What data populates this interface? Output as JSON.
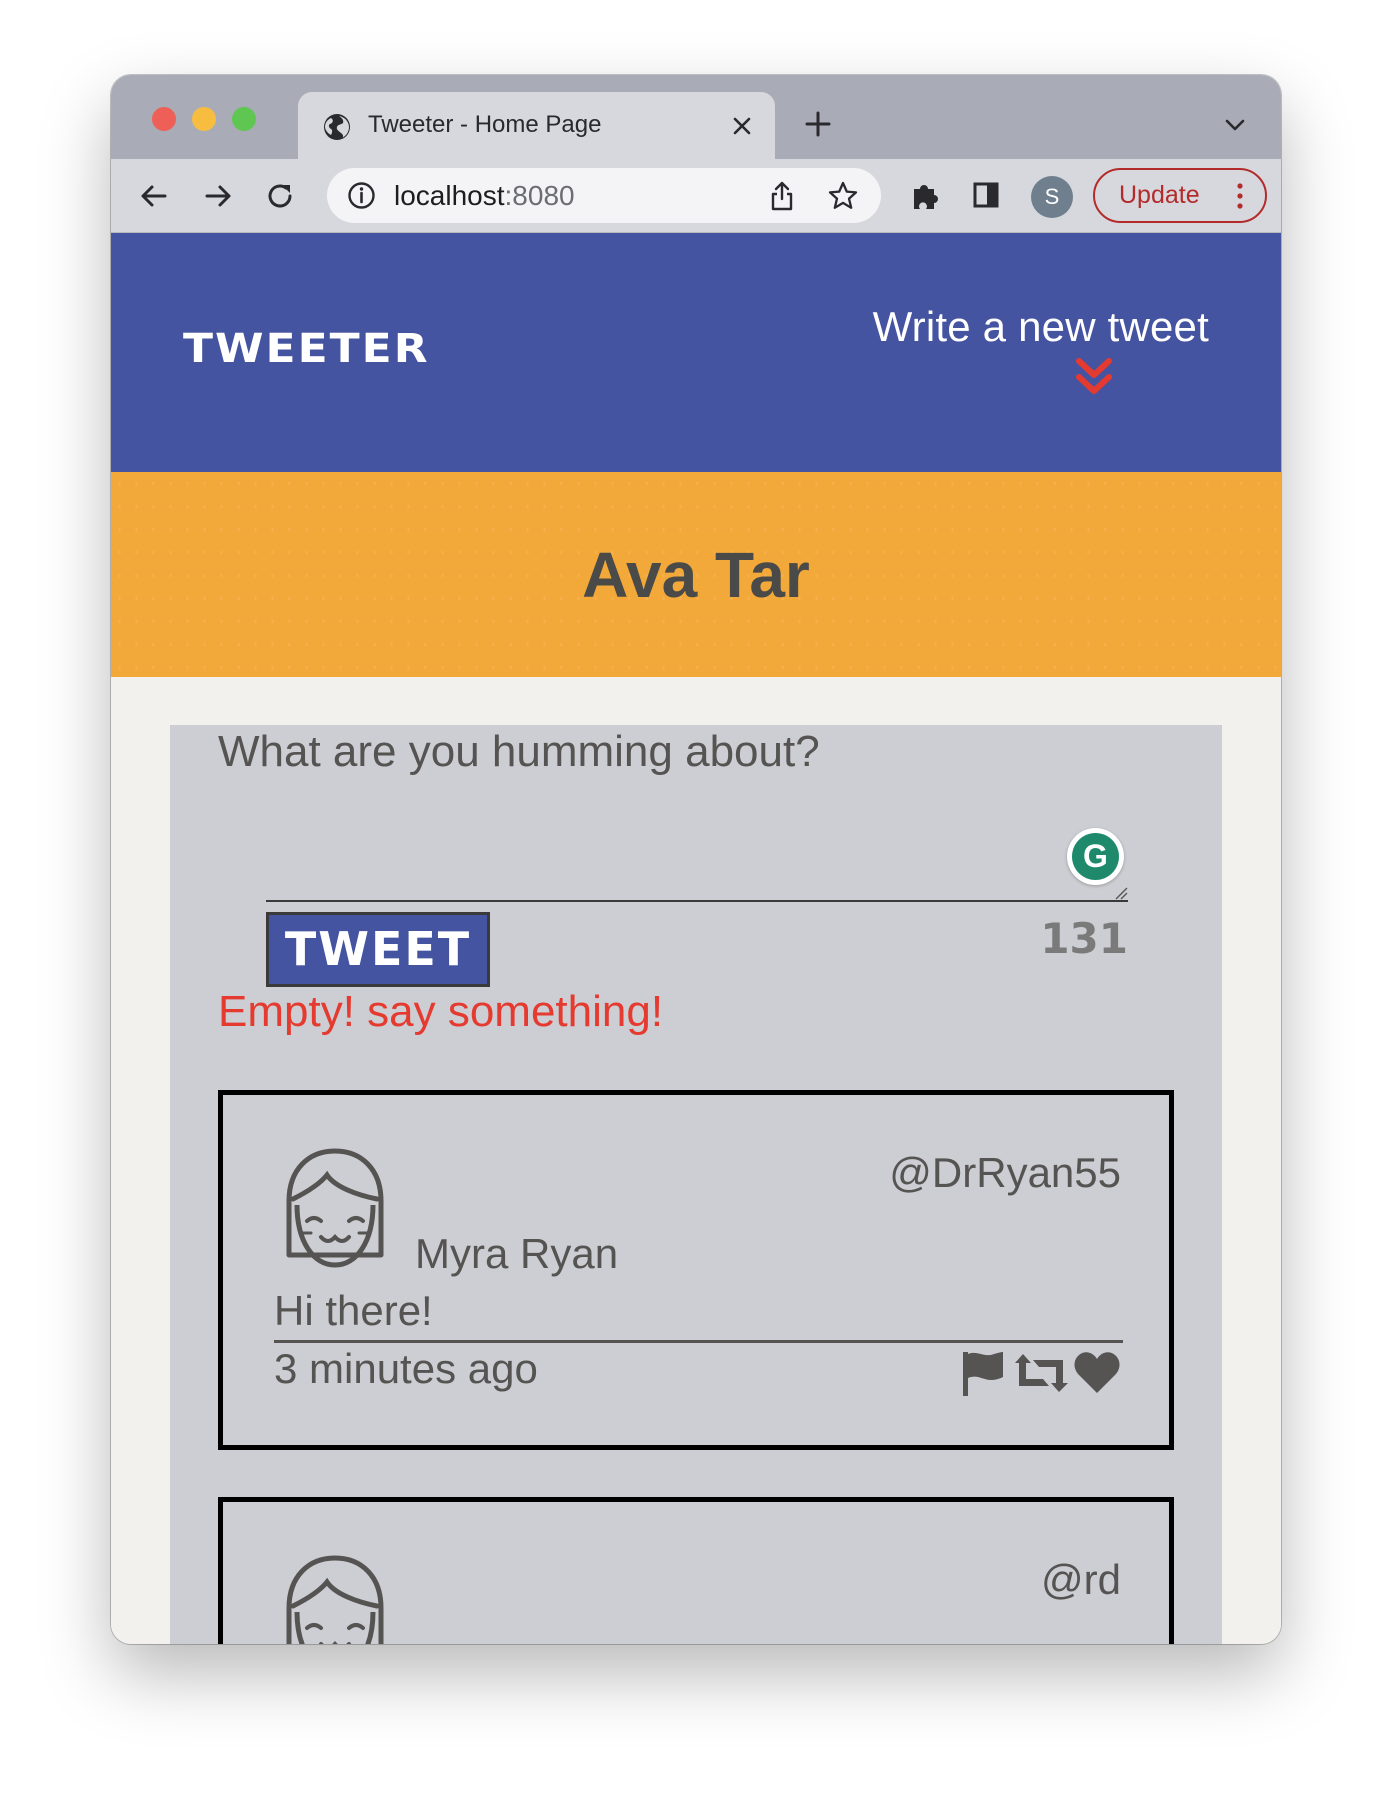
{
  "browser": {
    "tab_title": "Tweeter - Home Page",
    "url_host": "localhost",
    "url_port": ":8080",
    "profile_initial": "S",
    "update_label": "Update"
  },
  "header": {
    "brand": "Tweeter",
    "write_new": "Write a new tweet"
  },
  "profile": {
    "name": "Ava Tar"
  },
  "compose": {
    "label": "What are you humming about?",
    "button_label": "Tweet",
    "counter": "131",
    "error": "Empty! say something!"
  },
  "tweets": [
    {
      "handle": "@DrRyan55",
      "name": "Myra Ryan",
      "content": "Hi there!",
      "time": "3 minutes ago"
    },
    {
      "handle": "@rd"
    }
  ],
  "icons": {
    "tab_favicon": "globe-icon",
    "flag": "flag-icon",
    "retweet": "retweet-icon",
    "like": "heart-icon",
    "avatar": "girl-avatar-icon"
  },
  "colors": {
    "nav_bg": "#4554a0",
    "profile_bg": "#f3a83a",
    "error": "#e53a2f",
    "chevron": "#e53a2f",
    "container_bg": "#cdced3"
  }
}
